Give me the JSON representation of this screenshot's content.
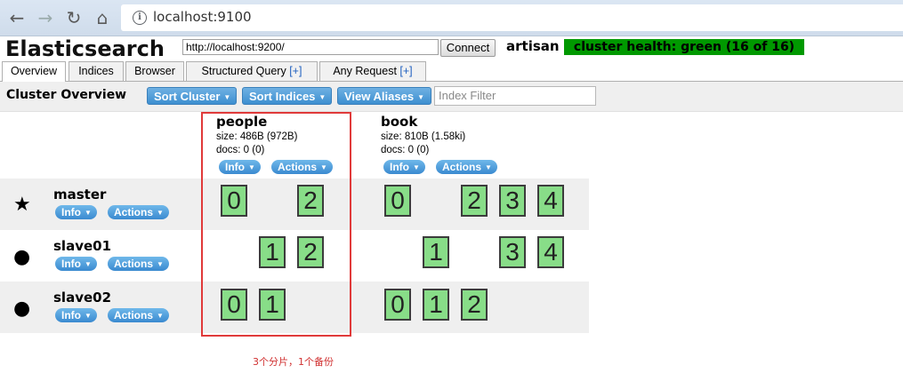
{
  "browser": {
    "url": "localhost:9100",
    "back_icon": "arrow-left-icon",
    "forward_icon": "arrow-right-icon",
    "reload_icon": "reload-icon",
    "home_icon": "home-icon",
    "info_icon": "info-icon"
  },
  "header": {
    "title": "Elasticsearch",
    "cluster_url": "http://localhost:9200/",
    "connect_label": "Connect",
    "cluster_name": "artisan",
    "health_text": "cluster health: green (16 of 16)",
    "health_color": "#009900"
  },
  "tabs": [
    {
      "label": "Overview",
      "plus": ""
    },
    {
      "label": "Indices",
      "plus": ""
    },
    {
      "label": "Browser",
      "plus": ""
    },
    {
      "label": "Structured Query",
      "plus": "[+]"
    },
    {
      "label": "Any Request",
      "plus": "[+]"
    }
  ],
  "toolbar": {
    "section_title": "Cluster Overview",
    "sort_cluster": "Sort Cluster",
    "sort_indices": "Sort Indices",
    "view_aliases": "View Aliases",
    "filter_placeholder": "Index Filter"
  },
  "indices": [
    {
      "name": "people",
      "size": "size: 486B (972B)",
      "docs": "docs: 0 (0)",
      "info": "Info",
      "actions": "Actions"
    },
    {
      "name": "book",
      "size": "size: 810B (1.58ki)",
      "docs": "docs: 0 (0)",
      "info": "Info",
      "actions": "Actions"
    }
  ],
  "nodes": [
    {
      "name": "master",
      "icon": "star-icon",
      "glyph": "★",
      "info": "Info",
      "actions": "Actions"
    },
    {
      "name": "slave01",
      "icon": "circle-icon",
      "glyph": "●",
      "info": "Info",
      "actions": "Actions"
    },
    {
      "name": "slave02",
      "icon": "circle-icon",
      "glyph": "●",
      "info": "Info",
      "actions": "Actions"
    }
  ],
  "shards": {
    "master": {
      "people": [
        "0",
        "",
        "2"
      ],
      "book": [
        "0",
        "",
        "2",
        "3",
        "4"
      ]
    },
    "slave01": {
      "people": [
        "",
        "1",
        "2"
      ],
      "book": [
        "",
        "1",
        "",
        "3",
        "4"
      ]
    },
    "slave02": {
      "people": [
        "0",
        "1",
        ""
      ],
      "book": [
        "0",
        "1",
        "2",
        "",
        ""
      ]
    }
  },
  "annotation": "3个分片，1个备份",
  "colors": {
    "shard": "#88dd88",
    "highlight": "#e03a3a",
    "button": "#3d8fd0"
  }
}
